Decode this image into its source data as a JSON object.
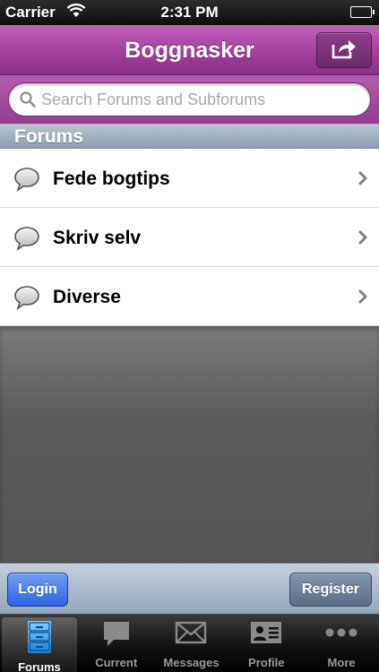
{
  "status_bar": {
    "carrier": "Carrier",
    "time": "2:31 PM"
  },
  "nav_bar": {
    "title": "Boggnasker",
    "accent_color": "#a23f9a"
  },
  "search": {
    "placeholder": "Search Forums and Subforums",
    "value": ""
  },
  "section_header": "Forums",
  "forums": [
    {
      "label": "Fede bogtips",
      "icon": "speech-bubble-icon"
    },
    {
      "label": "Skriv selv",
      "icon": "speech-bubble-icon"
    },
    {
      "label": "Diverse",
      "icon": "speech-bubble-icon"
    }
  ],
  "action_bar": {
    "login_label": "Login",
    "register_label": "Register"
  },
  "tab_bar": {
    "selected": "Forums",
    "tabs": [
      {
        "label": "Forums",
        "icon": "filing-cabinet-icon"
      },
      {
        "label": "Current",
        "icon": "speech-bubble-icon"
      },
      {
        "label": "Messages",
        "icon": "envelope-icon"
      },
      {
        "label": "Profile",
        "icon": "id-card-icon"
      },
      {
        "label": "More",
        "icon": "more-dots-icon"
      }
    ]
  }
}
